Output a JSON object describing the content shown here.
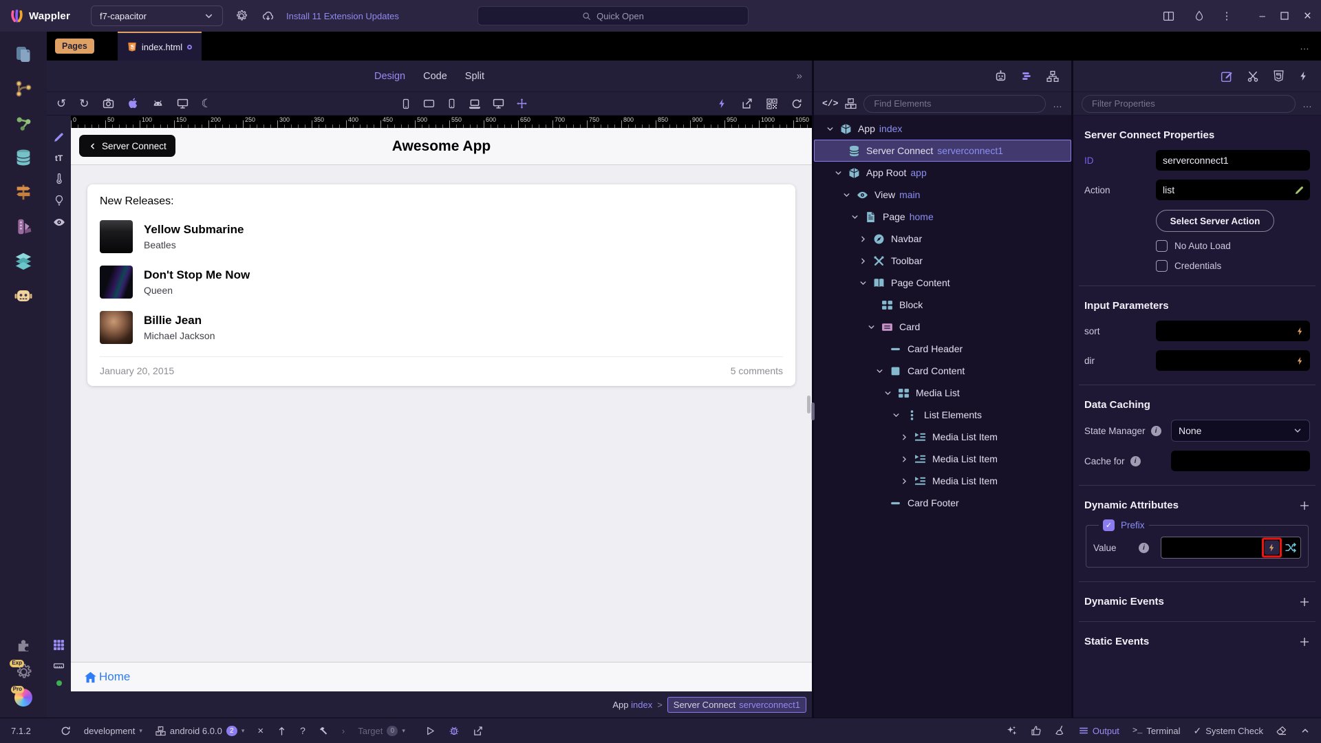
{
  "colors": {
    "accent": "#8b7cf0",
    "orange": "#e0a264",
    "tree_icon_teal": "#85bace",
    "card_icon_pink": "#c792c7",
    "highlight_red": "#ee1410",
    "f7_blue": "#2e7cf6",
    "action_pencil_green": "#a8c76a",
    "status_green": "#3fae4e"
  },
  "titlebar": {
    "app_name": "Wappler",
    "project": "f7-capacitor",
    "updates_link": "Install 11 Extension Updates",
    "quick_open": "Quick Open"
  },
  "tabs": {
    "pages_badge": "Pages",
    "file": "index.html"
  },
  "view_switch": {
    "design": "Design",
    "code": "Code",
    "split": "Split",
    "more": "»"
  },
  "ruler": {
    "labels": [
      "0",
      "50",
      "100",
      "150",
      "200",
      "250",
      "300",
      "350",
      "400",
      "450",
      "500",
      "550",
      "600",
      "650",
      "700",
      "750",
      "800",
      "850",
      "900",
      "950",
      "1000",
      "1050"
    ]
  },
  "canvas": {
    "back_button": "Server Connect",
    "title": "Awesome App",
    "card": {
      "header": "New Releases:",
      "items": [
        {
          "title": "Yellow Submarine",
          "subtitle": "Beatles"
        },
        {
          "title": "Don't Stop Me Now",
          "subtitle": "Queen"
        },
        {
          "title": "Billie Jean",
          "subtitle": "Michael Jackson"
        }
      ],
      "footer_date": "January 20, 2015",
      "footer_comments": "5 comments"
    },
    "toolbar_home": "Home"
  },
  "breadcrumb": {
    "app": "App",
    "app_id": "index",
    "separator": ">",
    "node": "Server Connect",
    "node_id": "serverconnect1"
  },
  "tree_panel": {
    "find_placeholder": "Find Elements",
    "rows": [
      {
        "label": "App",
        "id": "index"
      },
      {
        "label": "Server Connect",
        "id": "serverconnect1"
      },
      {
        "label": "App Root",
        "id": "app"
      },
      {
        "label": "View",
        "id": "main"
      },
      {
        "label": "Page",
        "id": "home"
      },
      {
        "label": "Navbar",
        "id": ""
      },
      {
        "label": "Toolbar",
        "id": ""
      },
      {
        "label": "Page Content",
        "id": ""
      },
      {
        "label": "Block",
        "id": ""
      },
      {
        "label": "Card",
        "id": ""
      },
      {
        "label": "Card Header",
        "id": ""
      },
      {
        "label": "Card Content",
        "id": ""
      },
      {
        "label": "Media List",
        "id": ""
      },
      {
        "label": "List Elements",
        "id": ""
      },
      {
        "label": "Media List Item",
        "id": ""
      },
      {
        "label": "Media List Item",
        "id": ""
      },
      {
        "label": "Media List Item",
        "id": ""
      },
      {
        "label": "Card Footer",
        "id": ""
      }
    ]
  },
  "props_panel": {
    "filter_placeholder": "Filter Properties",
    "title": "Server Connect Properties",
    "id_label": "ID",
    "id_value": "serverconnect1",
    "action_label": "Action",
    "action_value": "list",
    "select_action_button": "Select Server Action",
    "no_auto_load": "No Auto Load",
    "credentials": "Credentials",
    "input_parameters_title": "Input Parameters",
    "sort_label": "sort",
    "dir_label": "dir",
    "data_caching_title": "Data Caching",
    "state_manager_label": "State Manager",
    "state_manager_value": "None",
    "cache_for_label": "Cache for",
    "dynamic_attributes_title": "Dynamic Attributes",
    "prefix_label": "Prefix",
    "value_label": "Value",
    "dynamic_events_title": "Dynamic Events",
    "static_events_title": "Static Events"
  },
  "statusbar": {
    "version": "7.1.2",
    "environment": "development",
    "device": "android 6.0.0",
    "device_badge": "2",
    "target": "Target",
    "target_badge": "0",
    "output": "Output",
    "terminal": "Terminal",
    "system_check": "System Check"
  },
  "badges": {
    "experimental": "Exp",
    "pro": "Pro"
  },
  "misc": {
    "ellipsis": "…",
    "text_tool": "tT",
    "code_glyph": "</>",
    "terminal_glyph": ">_",
    "check": "✓",
    "minus": "–",
    "close": "×",
    "kebab": "⋮",
    "moon": "☾",
    "undo": "↺",
    "redo": "↻",
    "caret": "▾",
    "x_small": "×",
    "up_chevron_note": ""
  }
}
